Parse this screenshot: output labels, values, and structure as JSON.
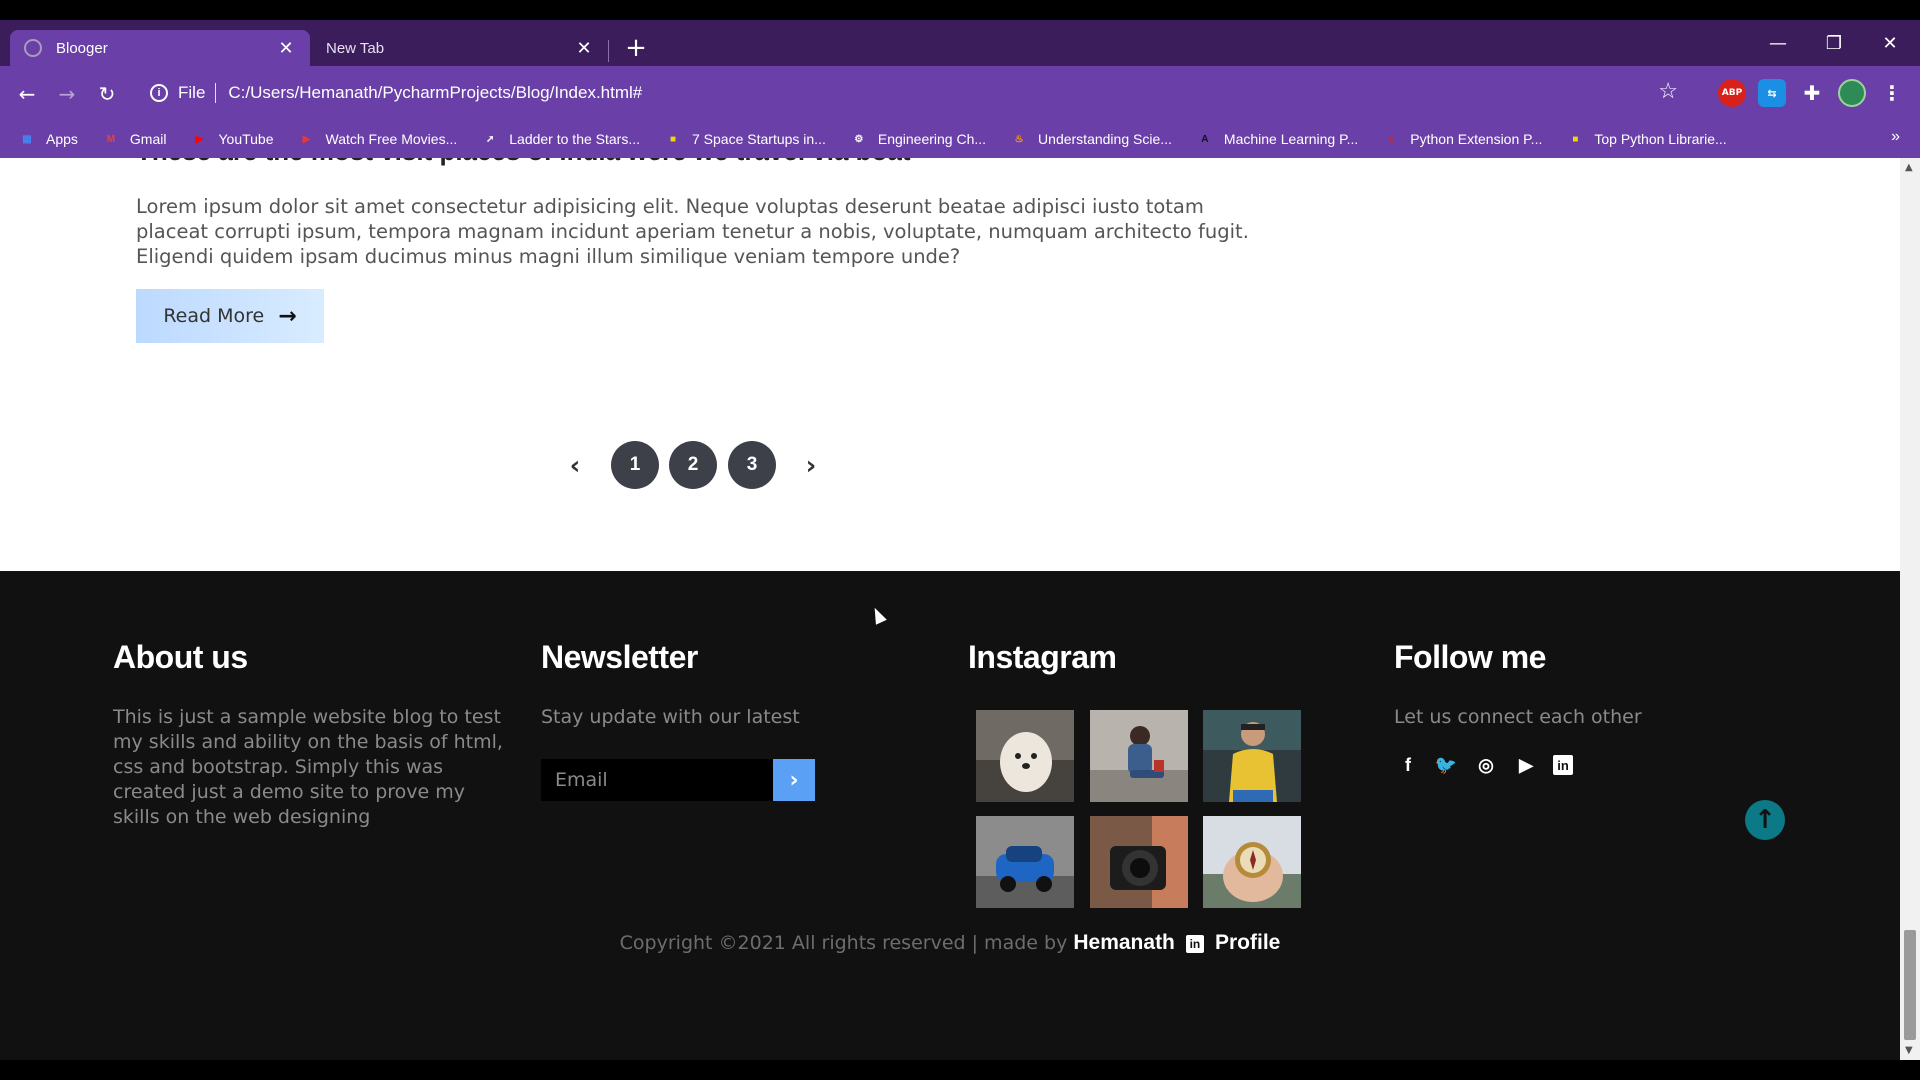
{
  "browser": {
    "tabs": [
      {
        "title": "Blooger",
        "active": true
      },
      {
        "title": "New Tab",
        "active": false
      }
    ],
    "window_controls": {
      "minimize": "—",
      "restore": "❐",
      "close": "✕"
    },
    "address": {
      "scheme": "File",
      "url": "C:/Users/Hemanath/PycharmProjects/Blog/Index.html#"
    },
    "extensions": {
      "abp": "ABP"
    },
    "bookmarks": [
      {
        "label": "Apps",
        "icon": "apps-grid-icon",
        "color": "#4285f4"
      },
      {
        "label": "Gmail",
        "icon": "gmail-icon",
        "color": "#ea4335"
      },
      {
        "label": "YouTube",
        "icon": "youtube-icon",
        "color": "#ff0000"
      },
      {
        "label": "Watch Free Movies...",
        "icon": "play-icon",
        "color": "#e53935"
      },
      {
        "label": "Ladder to the Stars...",
        "icon": "rocket-icon",
        "color": "#ffffff"
      },
      {
        "label": "7 Space Startups in...",
        "icon": "square-logo-icon",
        "color": "#f2d600"
      },
      {
        "label": "Engineering Ch...",
        "icon": "gear-icon",
        "color": "#ffffff"
      },
      {
        "label": "Understanding Scie...",
        "icon": "flame-icon",
        "color": "#ffa000"
      },
      {
        "label": "Machine Learning P...",
        "icon": "a-logo-icon",
        "color": "#111111"
      },
      {
        "label": "Python Extension P...",
        "icon": "x-logo-icon",
        "color": "#c62828"
      },
      {
        "label": "Top Python Librarie...",
        "icon": "square-logo-icon",
        "color": "#f2d600"
      }
    ],
    "bookmarks_more": "»"
  },
  "post": {
    "heading": "These are the most visit places of india were we travel via boat",
    "text": "Lorem ipsum dolor sit amet consectetur adipisicing elit. Neque voluptas deserunt beatae adipisci iusto totam placeat corrupti ipsum, tempora magnam incidunt aperiam tenetur a nobis, voluptate, numquam architecto fugit. Eligendi quidem ipsam ducimus minus magni illum similique veniam tempore unde?",
    "read_more": "Read More",
    "read_more_color": "#cfe4ff"
  },
  "pagination": {
    "prev": "‹",
    "pages": [
      "1",
      "2",
      "3"
    ],
    "next": "›"
  },
  "footer": {
    "about": {
      "title": "About us",
      "text": "This is just a sample website blog to test my skills and ability on the basis of html, css and bootstrap. Simply this was created just a demo site to prove my skills on the web designing"
    },
    "newsletter": {
      "title": "Newsletter",
      "text": "Stay update with our latest",
      "placeholder": "Email",
      "submit": "›"
    },
    "instagram": {
      "title": "Instagram",
      "photos": [
        "dog-photo",
        "girl-sitting-photo",
        "man-yellow-shirt-photo",
        "blue-car-photo",
        "camera-photo",
        "compass-photo"
      ]
    },
    "follow": {
      "title": "Follow me",
      "text": "Let us connect each other",
      "socials": [
        {
          "name": "facebook-icon",
          "glyph": "f"
        },
        {
          "name": "twitter-icon",
          "glyph": "🐦"
        },
        {
          "name": "instagram-icon",
          "glyph": "◎"
        },
        {
          "name": "youtube-icon",
          "glyph": "▶"
        },
        {
          "name": "linkedin-icon",
          "glyph": "in"
        }
      ]
    },
    "to_top": "↑",
    "copyright": {
      "text": "Copyright ©2021 All rights reserved | made by",
      "author": "Hemanath",
      "linkedin": "in",
      "profile": "Profile"
    }
  },
  "colors": {
    "chrome_dark": "#3b1d5c",
    "chrome_light": "#6a40a8",
    "footer_bg": "#111111",
    "accent_blue": "#5aa0f5",
    "pager_bg": "#3d4048",
    "to_top": "#0c7a86"
  }
}
